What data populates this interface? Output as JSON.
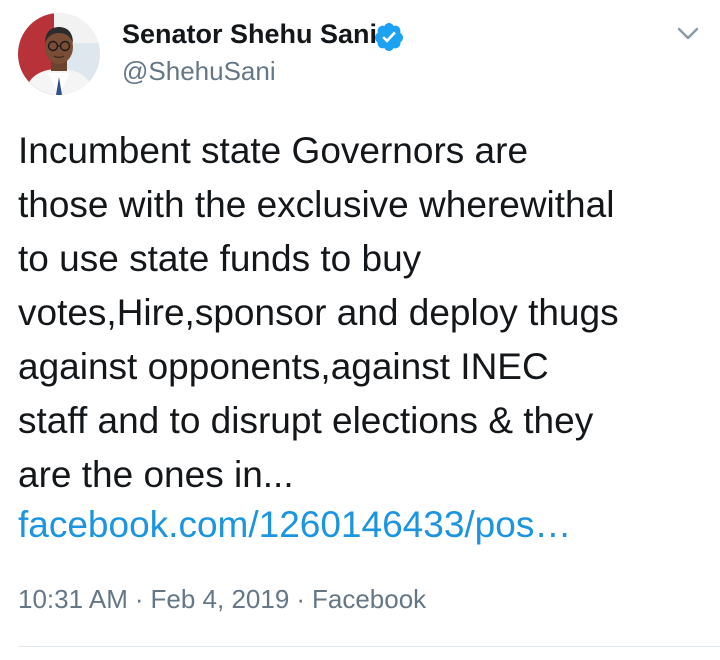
{
  "tweet": {
    "author": {
      "name": "Senator Shehu Sani",
      "handle": "@ShehuSani",
      "verified": true
    },
    "text_lines": [
      "Incumbent state Governors are",
      "those with the exclusive wherewithal",
      "to use state funds to buy",
      "votes,Hire,sponsor and deploy thugs",
      "against opponents,against INEC",
      "staff and to disrupt elections & they",
      "are the ones in..."
    ],
    "link": "facebook.com/1260146433/pos…",
    "meta": {
      "time": "10:31 AM",
      "separator": "·",
      "date": "Feb 4, 2019",
      "source": "Facebook"
    }
  },
  "colors": {
    "text": "#14171a",
    "secondary": "#657786",
    "link": "#1b95e0",
    "verified_badge": "#1da1f2",
    "divider": "#e1e8ed"
  },
  "icons": {
    "verified": "verified-badge-icon",
    "menu": "chevron-down-icon"
  }
}
